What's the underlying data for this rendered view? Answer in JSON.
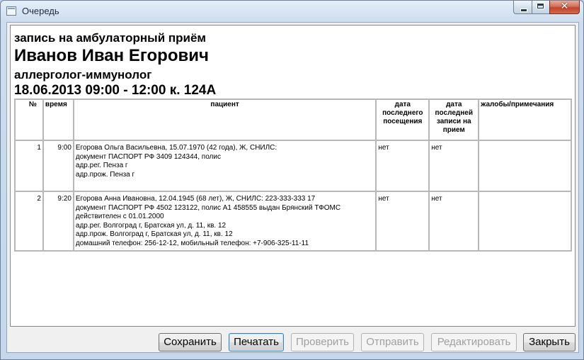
{
  "window": {
    "title": "Очередь"
  },
  "header": {
    "service": "запись на амбулаторный приём",
    "doctor": "Иванов Иван Егорович",
    "specialty": "аллерголог-иммунолог",
    "schedule": "18.06.2013 09:00 - 12:00 к. 124А"
  },
  "table": {
    "columns": [
      "№",
      "время",
      "пациент",
      "дата последнего посещения",
      "дата последней записи на прием",
      "жалобы/примечания"
    ],
    "rows": [
      {
        "num": "1",
        "time": "9:00",
        "patient": [
          "Егорова Ольга Васильевна, 15.07.1970 (42 года), Ж, СНИЛС:",
          "документ ПАСПОРТ РФ 3409 124344, полис",
          "адр.рег. Пенза г",
          "адр.прож. Пенза г"
        ],
        "last_visit": "нет",
        "last_record": "нет",
        "notes": ""
      },
      {
        "num": "2",
        "time": "9:20",
        "patient": [
          "Егорова Анна Ивановна, 12.04.1945 (68 лет), Ж, СНИЛС: 223-333-333 17",
          "документ ПАСПОРТ РФ 4502 123122, полис А1 458555 выдан Брянский ТФОМС",
          "действителен с 01.01.2000",
          "адр.рег. Волгоград г, Братская ул, д. 11, кв. 12",
          "адр.прож. Волгоград г, Братская ул, д. 11, кв. 12",
          "домашний телефон: 256-12-12, мобильный телефон: +7-906-325-11-11"
        ],
        "last_visit": "нет",
        "last_record": "нет",
        "notes": ""
      }
    ]
  },
  "buttons": {
    "save": "Сохранить",
    "print": "Печатать",
    "check": "Проверить",
    "send": "Отправить",
    "edit": "Редактировать",
    "close": "Закрыть"
  },
  "button_states": {
    "save": "enabled",
    "print": "focused",
    "check": "disabled",
    "send": "disabled",
    "edit": "disabled",
    "close": "enabled"
  },
  "colors": {
    "close_button": "#c1442a",
    "disabled_text": "#a0a0a0"
  }
}
